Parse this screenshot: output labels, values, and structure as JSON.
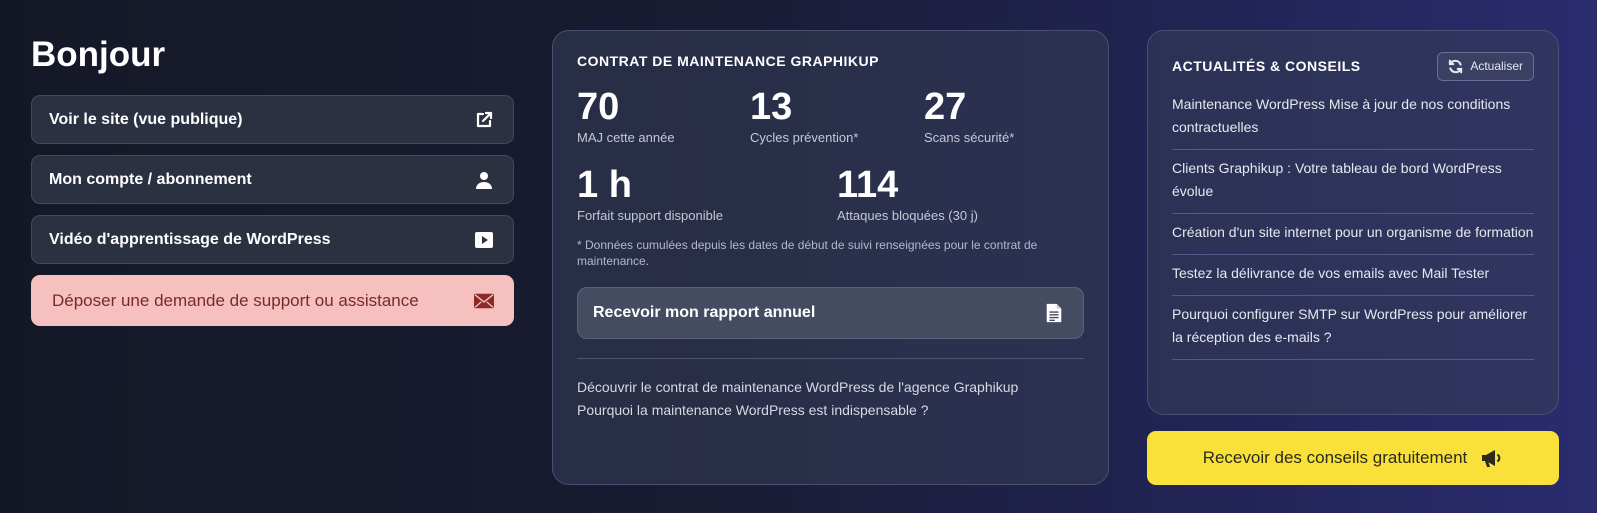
{
  "greeting": "Bonjour",
  "links": {
    "site": "Voir le site (vue publique)",
    "account": "Mon compte / abonnement",
    "video": "Vidéo d'apprentissage de WordPress",
    "support": "Déposer une demande de support ou assistance"
  },
  "maintenance": {
    "title": "CONTRAT DE MAINTENANCE GRAPHIKUP",
    "stats": [
      {
        "value": "70",
        "label": "MAJ cette année"
      },
      {
        "value": "13",
        "label": "Cycles prévention*"
      },
      {
        "value": "27",
        "label": "Scans sécurité*"
      },
      {
        "value": "1 h",
        "label": "Forfait support disponible"
      },
      {
        "value": "114",
        "label": "Attaques bloquées (30 j)"
      }
    ],
    "note": "* Données cumulées depuis les dates de début de suivi renseignées pour le contrat de maintenance.",
    "report_button": "Recevoir mon rapport annuel",
    "links": [
      "Découvrir le contrat de maintenance WordPress de l'agence Graphikup",
      "Pourquoi la maintenance WordPress est indispensable ?"
    ]
  },
  "news": {
    "title": "ACTUALITÉS & CONSEILS",
    "refresh_label": "Actualiser",
    "items": [
      "Maintenance WordPress  Mise à jour de nos conditions contractuelles",
      "Clients Graphikup : Votre tableau de bord WordPress évolue",
      "Création d'un site internet pour un organisme de formation",
      "Testez la délivrance de vos emails avec Mail Tester",
      "Pourquoi configurer SMTP sur WordPress pour améliorer la réception des e-mails ?"
    ]
  },
  "tips_button": "Recevoir des conseils gratuitement",
  "icons": {
    "site": "external-link-icon",
    "account": "user-icon",
    "video": "play-icon",
    "support": "envelope-icon",
    "report": "document-icon",
    "refresh": "refresh-icon",
    "tips": "megaphone-icon"
  },
  "colors": {
    "support_bg": "#f5c0bd",
    "tips_bg": "#f9e13a"
  }
}
